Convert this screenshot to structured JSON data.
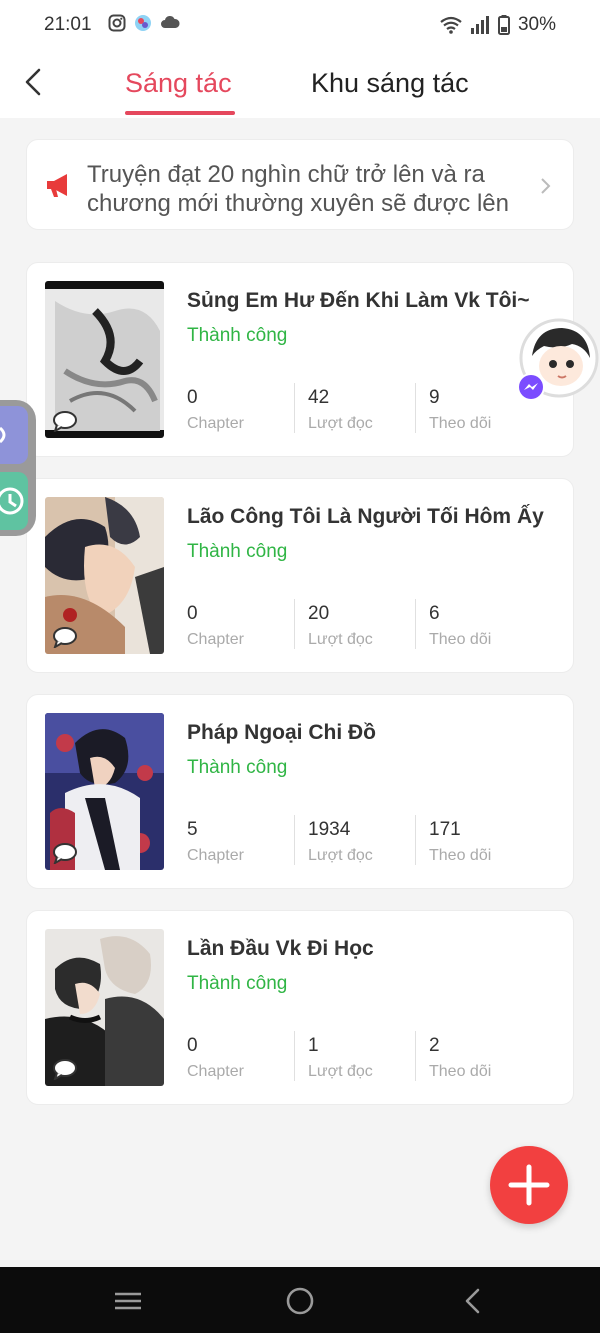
{
  "status_bar": {
    "time": "21:01",
    "battery": "30%",
    "left_icons": [
      "instagram-icon",
      "app-icon",
      "cloud-icon"
    ],
    "right_icons": [
      "wifi-icon",
      "signal-icon",
      "battery-icon"
    ]
  },
  "header": {
    "tabs": [
      {
        "label": "Sáng tác",
        "active": true
      },
      {
        "label": "Khu sáng tác",
        "active": false
      }
    ]
  },
  "notice": {
    "text": "Truyện đạt 20 nghìn chữ trở lên và ra chương mới thường xuyên sẽ được lên"
  },
  "stories": [
    {
      "title": "Sủng Em Hư Đến Khi Làm Vk Tôi~",
      "status": "Thành công",
      "chapters": "0",
      "chapters_label": "Chapter",
      "reads": "42",
      "reads_label": "Lượt đọc",
      "follows": "9",
      "follows_label": "Theo dõi"
    },
    {
      "title": "Lão Công Tôi Là Người Tối Hôm Ấy",
      "status": "Thành công",
      "chapters": "0",
      "chapters_label": "Chapter",
      "reads": "20",
      "reads_label": "Lượt đọc",
      "follows": "6",
      "follows_label": "Theo dõi"
    },
    {
      "title": "Pháp Ngoại Chi Đồ",
      "status": "Thành công",
      "chapters": "5",
      "chapters_label": "Chapter",
      "reads": "1934",
      "reads_label": "Lượt đọc",
      "follows": "171",
      "follows_label": "Theo dõi"
    },
    {
      "title": "Lần Đầu Vk Đi Học",
      "status": "Thành công",
      "chapters": "0",
      "chapters_label": "Chapter",
      "reads": "1",
      "reads_label": "Lượt đọc",
      "follows": "2",
      "follows_label": "Theo dõi"
    }
  ],
  "fab": {
    "icon": "plus-icon"
  },
  "nav_bar": {
    "icons": [
      "recent-apps-icon",
      "home-icon",
      "back-icon"
    ]
  },
  "colors": {
    "accent": "#e5485d",
    "success": "#30b545",
    "fab": "#f24040"
  }
}
